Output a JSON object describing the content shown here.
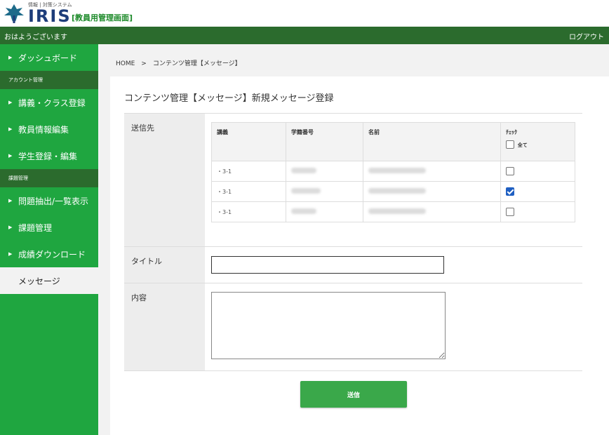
{
  "brand": {
    "subtitle": "情報 | 対策システム",
    "name": "IRIS",
    "panel_label": "[教員用管理画面]",
    "logo_icon": "tree-logo-icon"
  },
  "topbar": {
    "greeting": "おはようございます",
    "logout": "ログアウト"
  },
  "sidebar": {
    "items": [
      {
        "type": "item",
        "label": "ダッシュボード"
      },
      {
        "type": "section",
        "label": "アカウント管理"
      },
      {
        "type": "item",
        "label": "講義・クラス登録"
      },
      {
        "type": "item",
        "label": "教員情報編集"
      },
      {
        "type": "item",
        "label": "学生登録・編集"
      },
      {
        "type": "section",
        "label": "課題管理"
      },
      {
        "type": "item",
        "label": "問題抽出/一覧表示"
      },
      {
        "type": "item",
        "label": "課題管理"
      },
      {
        "type": "item",
        "label": "成績ダウンロード"
      },
      {
        "type": "item",
        "label": "メッセージ",
        "active": true
      }
    ]
  },
  "breadcrumb": "HOME　>　コンテンツ管理【メッセージ】",
  "page_title": "コンテンツ管理【メッセージ】新規メッセージ登録",
  "form": {
    "recipients_label": "送信先",
    "title_label": "タイトル",
    "content_label": "内容",
    "title_value": "",
    "content_value": ""
  },
  "table": {
    "headers": [
      "講義",
      "学籍番号",
      "名前",
      "ﾁｪｯｸ"
    ],
    "select_all_label": "全て",
    "select_all_checked": false,
    "rows": [
      {
        "course": "・3-1",
        "checked": false
      },
      {
        "course": "・3-1",
        "checked": true
      },
      {
        "course": "・3-1",
        "checked": false
      }
    ]
  },
  "submit_label": "送信",
  "colors": {
    "sidebar": "#1fa640",
    "topbar": "#2b6b2d",
    "button": "#3aa84a",
    "brand_text": "#1e3d7a"
  }
}
